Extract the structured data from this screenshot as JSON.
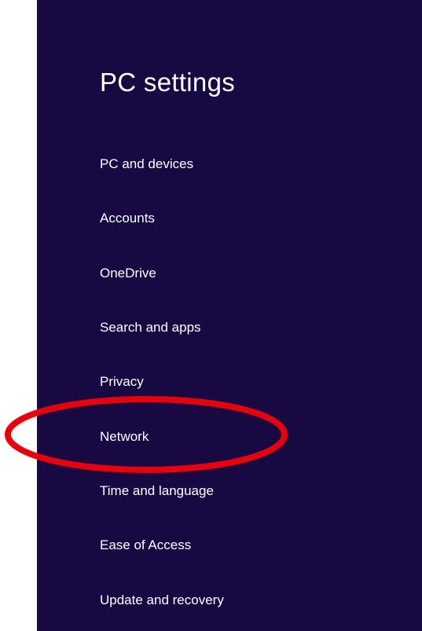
{
  "header": {
    "title": "PC settings"
  },
  "nav": {
    "items": [
      {
        "label": "PC and devices"
      },
      {
        "label": "Accounts"
      },
      {
        "label": "OneDrive"
      },
      {
        "label": "Search and apps"
      },
      {
        "label": "Privacy"
      },
      {
        "label": "Network",
        "highlighted": true
      },
      {
        "label": "Time and language"
      },
      {
        "label": "Ease of Access"
      },
      {
        "label": "Update and recovery"
      }
    ]
  },
  "colors": {
    "panel_background": "#170a43",
    "text": "#ffffff",
    "annotation": "#e8000b"
  },
  "annotation": {
    "shape": "ellipse",
    "target": "Network"
  }
}
